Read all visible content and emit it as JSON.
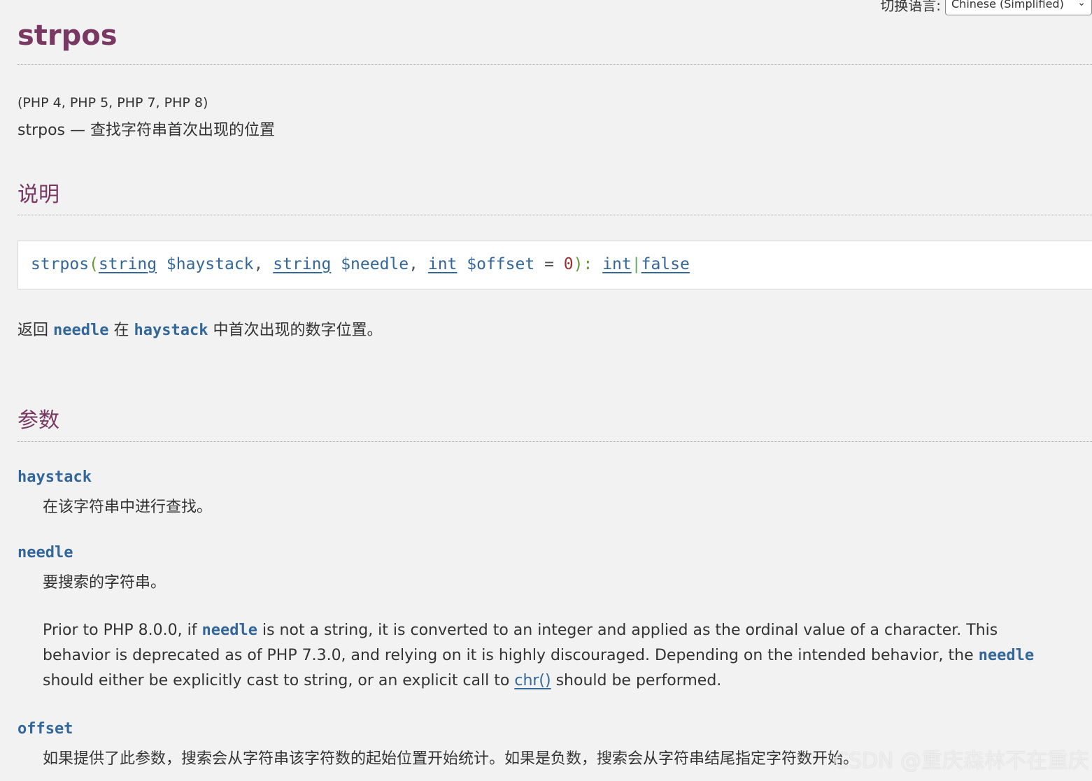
{
  "language_switcher": {
    "label": "切换语言:",
    "selected": "Chinese (Simplified)"
  },
  "title": "strpos",
  "versions": "(PHP 4, PHP 5, PHP 7, PHP 8)",
  "refpurpose": "strpos — 查找字符串首次出现的位置",
  "sections": {
    "description_heading": "说明",
    "parameters_heading": "参数"
  },
  "synopsis": {
    "func": "strpos",
    "open_paren": "(",
    "p1_type": "string",
    "p1_name": "$haystack",
    "comma1": ",",
    "p2_type": "string",
    "p2_name": "$needle",
    "comma2": ",",
    "p3_type": "int",
    "p3_name": "$offset",
    "equals": "=",
    "p3_default": "0",
    "close": "):",
    "ret_type1": "int",
    "bar": "|",
    "ret_type2": "false"
  },
  "return_desc": {
    "pre": "返回 ",
    "needle": "needle",
    "mid": " 在 ",
    "haystack": "haystack",
    "post": " 中首次出现的数字位置。"
  },
  "parameters": {
    "haystack": {
      "term": "haystack",
      "desc": "在该字符串中进行查找。"
    },
    "needle": {
      "term": "needle",
      "desc": "要搜索的字符串。",
      "note_part1": "Prior to PHP 8.0.0, if ",
      "note_code1": "needle",
      "note_part2": " is not a string, it is converted to an integer and applied as the ordinal value of a character. This behavior is deprecated as of PHP 7.3.0, and relying on it is highly discouraged. Depending on the intended behavior, the ",
      "note_code2": "needle",
      "note_part3": " should either be explicitly cast to string, or an explicit call to ",
      "note_link": "chr()",
      "note_part4": " should be performed."
    },
    "offset": {
      "term": "offset",
      "desc": "如果提供了此参数，搜索会从字符串该字符数的起始位置开始统计。如果是负数，搜索会从字符串结尾指定字符数开始。"
    }
  },
  "watermark": "CSDN @重庆森林不在重庆"
}
